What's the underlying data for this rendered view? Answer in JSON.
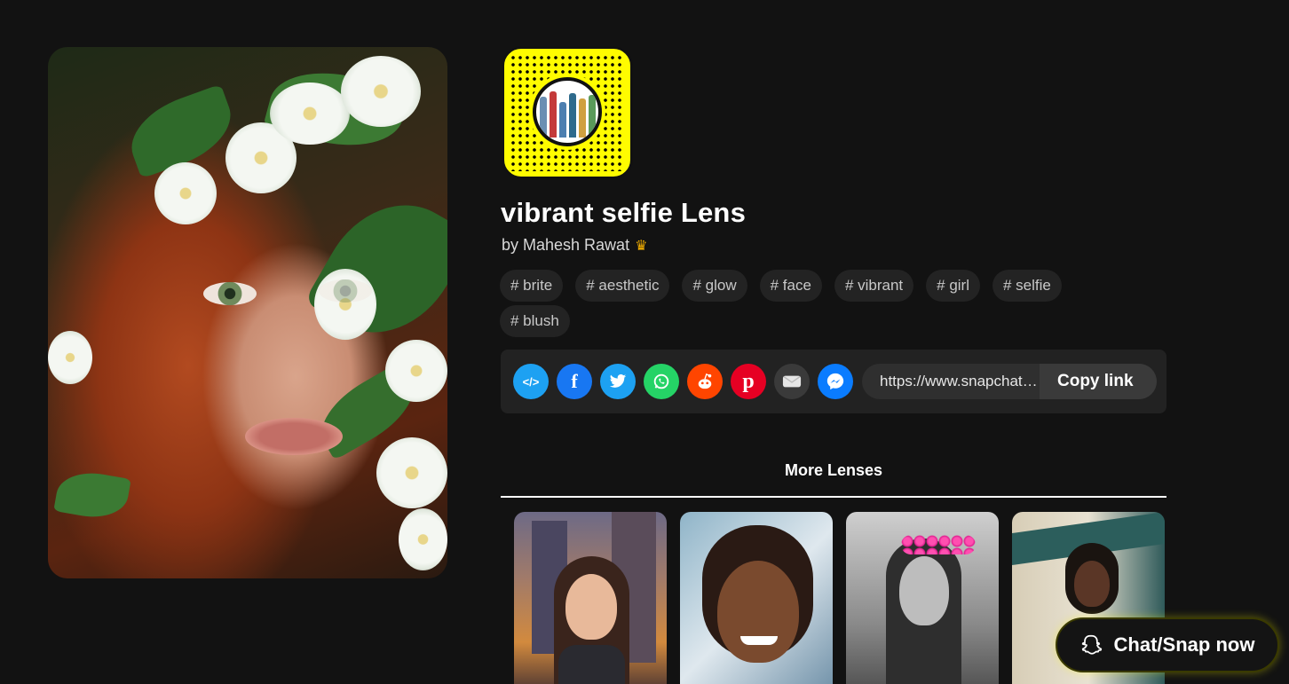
{
  "lens": {
    "title": "vibrant selfie Lens",
    "author": "by Mahesh Rawat",
    "author_badge_icon": "crown-icon"
  },
  "tags": [
    "# brite",
    "# aesthetic",
    "# glow",
    "# face",
    "# vibrant",
    "# girl",
    "# selfie",
    "# blush"
  ],
  "share": {
    "icons": [
      {
        "name": "embed-icon",
        "glyph": "</>",
        "color": "#1da1f2"
      },
      {
        "name": "facebook-icon",
        "glyph": "f",
        "color": "#1877f2"
      },
      {
        "name": "twitter-icon",
        "glyph": "t",
        "color": "#1da1f2"
      },
      {
        "name": "whatsapp-icon",
        "glyph": "w",
        "color": "#25d366"
      },
      {
        "name": "reddit-icon",
        "glyph": "r",
        "color": "#ff4500"
      },
      {
        "name": "pinterest-icon",
        "glyph": "p",
        "color": "#e60023"
      },
      {
        "name": "email-icon",
        "glyph": "✉",
        "color": "#3a3a3a"
      },
      {
        "name": "messenger-icon",
        "glyph": "m",
        "color": "#0a7cff"
      }
    ],
    "link": "https://www.snapchat.com/lens/",
    "copy_label": "Copy link"
  },
  "more": {
    "title": "More Lenses"
  },
  "chat": {
    "label": "Chat/Snap now"
  },
  "colors": {
    "background": "#121212",
    "snapcode_yellow": "#fffc00",
    "tag_bg": "#232323",
    "share_bar_bg": "#222222"
  }
}
